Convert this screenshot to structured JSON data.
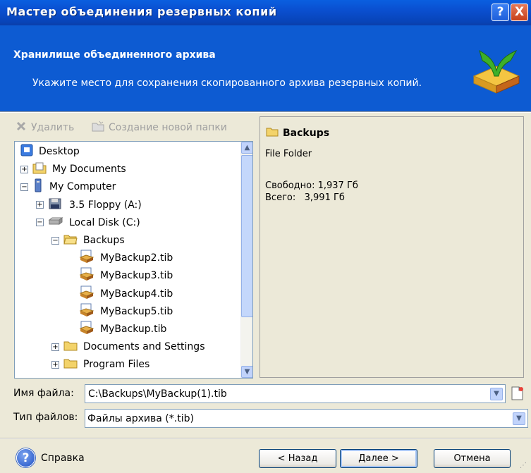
{
  "window": {
    "title": "Мастер объединения резервных копий",
    "help_glyph": "?",
    "close_glyph": "X"
  },
  "header": {
    "title": "Хранилище объединенного архива",
    "subtitle": "Укажите место для сохранения скопированного архива резервных копий."
  },
  "toolbar": {
    "delete_label": "Удалить",
    "new_folder_label": "Создание новой папки"
  },
  "tree": [
    {
      "label": "Desktop",
      "icon": "desktop-icon",
      "toggle": ""
    },
    {
      "label": "My Documents",
      "icon": "folder-documents-icon",
      "toggle": "+"
    },
    {
      "label": "My Computer",
      "icon": "computer-icon",
      "toggle": "−"
    },
    {
      "label": "3.5 Floppy (A:)",
      "icon": "floppy-icon",
      "toggle": "+"
    },
    {
      "label": "Local Disk (C:)",
      "icon": "disk-icon",
      "toggle": "−"
    },
    {
      "label": "Backups",
      "icon": "folder-open-icon",
      "toggle": "−"
    },
    {
      "label": "MyBackup2.tib",
      "icon": "backup-file-icon",
      "toggle": ""
    },
    {
      "label": "MyBackup3.tib",
      "icon": "backup-file-icon",
      "toggle": ""
    },
    {
      "label": "MyBackup4.tib",
      "icon": "backup-file-icon",
      "toggle": ""
    },
    {
      "label": "MyBackup5.tib",
      "icon": "backup-file-icon",
      "toggle": ""
    },
    {
      "label": "MyBackup.tib",
      "icon": "backup-file-icon",
      "toggle": ""
    },
    {
      "label": "Documents and Settings",
      "icon": "folder-icon",
      "toggle": "+"
    },
    {
      "label": "Program Files",
      "icon": "folder-icon",
      "toggle": "+"
    }
  ],
  "info": {
    "name": "Backups",
    "type": "File Folder",
    "free": "Свободно: 1,937 Гб",
    "total": "Всего:   3,991 Гб"
  },
  "filename": {
    "label": "Имя файла:",
    "value": "C:\\Backups\\MyBackup(1).tib"
  },
  "filetype": {
    "label": "Тип файлов:",
    "value": "Файлы архива (*.tib)"
  },
  "buttons": {
    "help": "Справка",
    "back": "< Назад",
    "next": "Далее >",
    "cancel": "Отмена"
  },
  "colors": {
    "header_bg": "#0D5BD2",
    "dialog_bg": "#ECE9D8",
    "accent": "#0A4FD0"
  }
}
